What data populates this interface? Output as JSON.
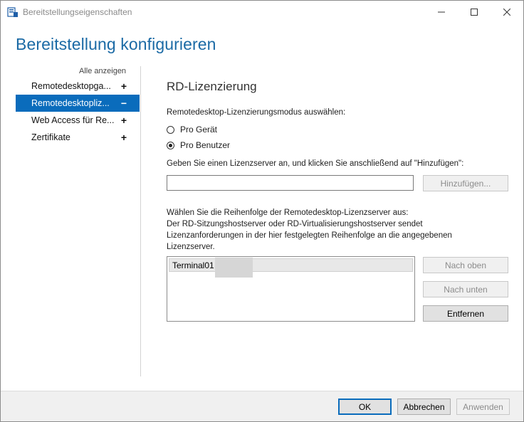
{
  "window": {
    "title": "Bereitstellungseigenschaften",
    "controls": {
      "minimize": "minimize-icon",
      "maximize": "maximize-icon",
      "close": "close-icon"
    }
  },
  "header": {
    "title": "Bereitstellung konfigurieren"
  },
  "sidebar": {
    "show_all": "Alle anzeigen",
    "items": [
      {
        "label": "Remotedesktopga...",
        "toggle": "+",
        "selected": false
      },
      {
        "label": "Remotedesktopliz...",
        "toggle": "−",
        "selected": true
      },
      {
        "label": "Web Access für Re...",
        "toggle": "+",
        "selected": false
      },
      {
        "label": "Zertifikate",
        "toggle": "+",
        "selected": false
      }
    ]
  },
  "main": {
    "section_title": "RD-Lizenzierung",
    "mode_prompt": "Remotedesktop-Lizenzierungsmodus auswählen:",
    "radios": [
      {
        "label": "Pro Gerät",
        "checked": false
      },
      {
        "label": "Pro Benutzer",
        "checked": true
      }
    ],
    "server_prompt": "Geben Sie einen Lizenzserver an, und klicken Sie anschließend auf \"Hinzufügen\":",
    "server_input": {
      "value": "",
      "placeholder": ""
    },
    "add_button": "Hinzufügen...",
    "order_text": [
      "Wählen Sie die Reihenfolge der Remotedesktop-Lizenzserver aus:",
      "Der RD-Sitzungshostserver oder RD-Virtualisierungshostserver sendet",
      "Lizenzanforderungen in der hier festgelegten Reihenfolge an die angegebenen",
      "Lizenzserver."
    ],
    "server_list": [
      "Terminal01"
    ],
    "move_up_button": "Nach oben",
    "move_down_button": "Nach unten",
    "remove_button": "Entfernen"
  },
  "footer": {
    "ok": "OK",
    "cancel": "Abbrechen",
    "apply": "Anwenden"
  },
  "colors": {
    "accent": "#0a6cbc",
    "header_text": "#1b6aa5",
    "footer_bg": "#f0f0f0"
  }
}
